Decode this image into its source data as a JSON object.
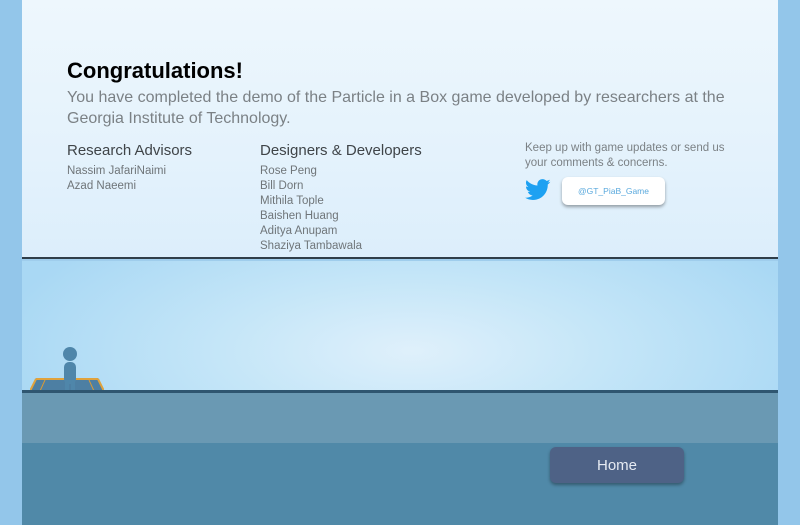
{
  "header": {
    "title": "Congratulations!",
    "intro": "You have completed the demo of the Particle in a Box game developed by researchers at the Georgia Institute of Technology."
  },
  "credits": {
    "advisors": {
      "heading": "Research Advisors",
      "names": [
        "Nassim JafariNaimi",
        "Azad Naeemi"
      ]
    },
    "developers": {
      "heading": "Designers & Developers",
      "names": [
        "Rose Peng",
        "Bill Dorn",
        "Mithila Tople",
        "Baishen Huang",
        "Aditya Anupam",
        "Shaziya Tambawala"
      ]
    }
  },
  "social": {
    "text": "Keep up with game updates or send us your comments & concerns.",
    "icon": "twitter-bird-icon",
    "handle_label": "@GT_PiaB_Game"
  },
  "controls": {
    "home_label": "Home"
  },
  "colors": {
    "twitter": "#1da1f2",
    "home_button": "#4e6286",
    "ground": "#5089a8",
    "sky": "#a9d8f4"
  }
}
